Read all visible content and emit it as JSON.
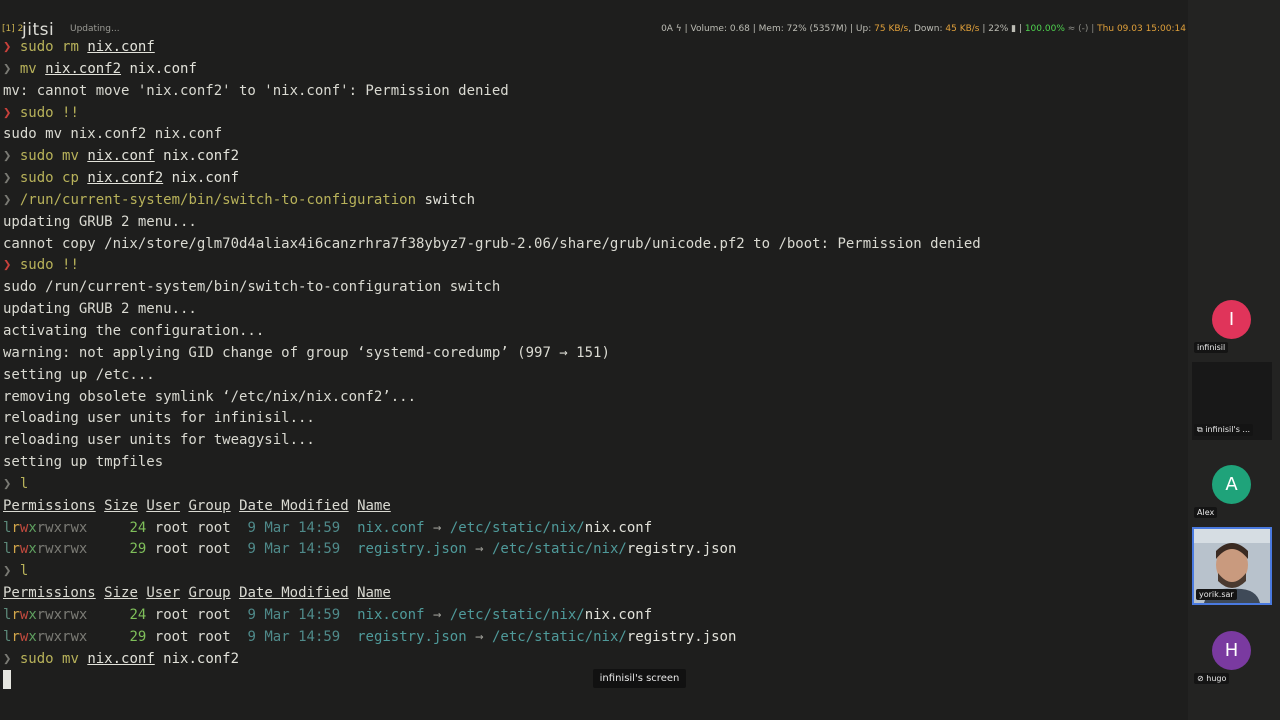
{
  "statusbar": {
    "workspaces": "[1] 2",
    "app_title": "Updating...",
    "status_prefix": "0A ϟ | Volume: 0.68 | Mem: 72% (5357M) | Up: ",
    "up_speed": "75 KB/s",
    "down_label": ", Down: ",
    "down_speed": "45 KB/s",
    "battery": " | 22% ▮ | ",
    "charge": "100.00%",
    "charge_suffix": " ≈ (-) | ",
    "datetime": "Thu 09.03 15:00:14"
  },
  "logo": "jitsi",
  "terminal": {
    "prompt": "❯",
    "lines": {
      "l1": {
        "cmd": "sudo",
        "sub": " rm ",
        "arg": "nix.conf"
      },
      "l2": {
        "cmd": "mv",
        "arg1": "nix.conf2",
        "rest": " nix.conf"
      },
      "l3": "mv: cannot move 'nix.conf2' to 'nix.conf': Permission denied",
      "l4": {
        "cmd": "sudo",
        "rest": " !!"
      },
      "l5": "sudo mv nix.conf2 nix.conf",
      "l6": {
        "cmd": "sudo",
        "sub": " mv ",
        "arg": "nix.conf",
        "rest": " nix.conf2"
      },
      "l7": {
        "cmd": "sudo",
        "sub": " cp ",
        "arg": "nix.conf2",
        "rest": " nix.conf"
      },
      "l8": {
        "cmd": "/run/current-system/bin/switch-to-configuration",
        "rest": " switch"
      },
      "l9": "updating GRUB 2 menu...",
      "l10": "cannot copy /nix/store/glm70d4aliax4i6canzrhra7f38ybyz7-grub-2.06/share/grub/unicode.pf2 to /boot: Permission denied",
      "l11": {
        "cmd": "sudo",
        "rest": " !!"
      },
      "l12": "sudo /run/current-system/bin/switch-to-configuration switch",
      "l13": "updating GRUB 2 menu...",
      "l14": "activating the configuration...",
      "l15": "warning: not applying GID change of group ‘systemd-coredump’ (997 → 151)",
      "l16": "setting up /etc...",
      "l17": "removing obsolete symlink ‘/etc/nix/nix.conf2’...",
      "l18": "reloading user units for infinisil...",
      "l19": "reloading user units for tweagysil...",
      "l20": "setting up tmpfiles",
      "l21": {
        "cmd": "l"
      },
      "table_headers": [
        "Permissions",
        "Size",
        "User",
        "Group",
        "Date Modified",
        "Name"
      ],
      "row1": {
        "size": "24",
        "user": "root",
        "group": "root",
        "date": "9 Mar 14:59",
        "name": "nix.conf",
        "arrow": "→",
        "dir": "/etc/static/nix/",
        "file": "nix.conf"
      },
      "row2": {
        "size": "29",
        "user": "root",
        "group": "root",
        "date": "9 Mar 14:59",
        "name": "registry.json",
        "arrow": "→",
        "dir": "/etc/static/nix/",
        "file": "registry.json"
      },
      "l25": {
        "cmd": "l"
      },
      "l29": {
        "cmd": "sudo",
        "sub": " mv ",
        "arg": "nix.conf",
        "rest": " nix.conf2"
      }
    }
  },
  "screen_label": "infinisil's screen",
  "participants": [
    {
      "initial": "I",
      "name": "infinisil",
      "color": "#e0345a"
    },
    {
      "name": "infinisil's ..."
    },
    {
      "initial": "A",
      "name": "Alex",
      "color": "#1fa37a"
    },
    {
      "name": "yorik.sar"
    },
    {
      "initial": "H",
      "name": "hugo",
      "color": "#7a3aa0"
    }
  ]
}
